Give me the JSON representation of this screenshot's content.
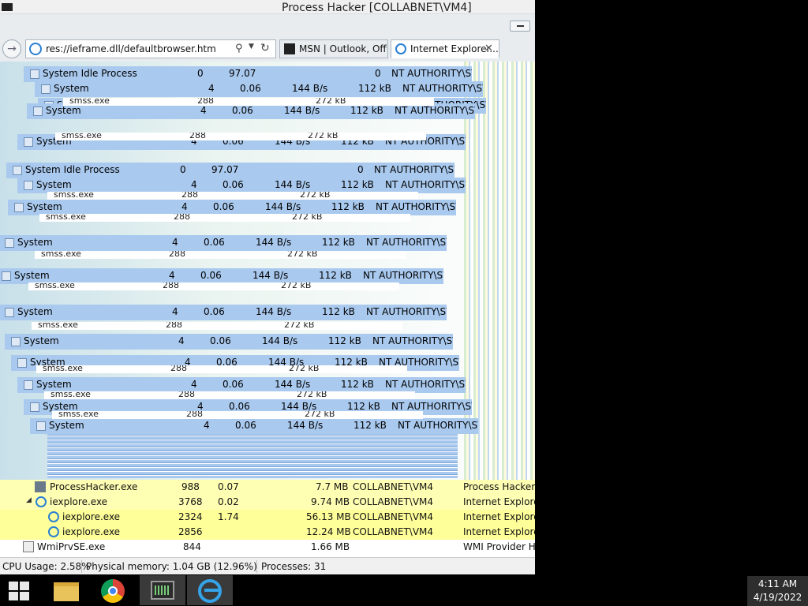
{
  "window": {
    "title": "Process Hacker [COLLABNET\\VM4]"
  },
  "browser": {
    "address": "res://ieframe.dll/defaultbrowser.htm",
    "tabs": [
      {
        "label": "MSN | Outlook, Off..."
      },
      {
        "label": "Internet Explorer..."
      }
    ],
    "icons": {
      "forward": "forward-arrow-icon",
      "search": "search-icon",
      "refresh": "refresh-icon",
      "close": "close-icon"
    },
    "glyphs": {
      "forward": "→",
      "search": "⚲",
      "dropdown": "▼",
      "refresh": "↻",
      "close": "✕"
    }
  },
  "glitched_list": {
    "system_idle": {
      "name": "System Idle Process",
      "pid": "0",
      "cpu": "97.07",
      "mem": "0",
      "user": "NT AUTHORITY\\SYSTE"
    },
    "system": {
      "name": "System",
      "pid": "4",
      "cpu": "0.06",
      "io": "144 B/s",
      "mem": "112 kB",
      "user": "NT AUTHORITY\\SYSTE"
    },
    "smss": {
      "name": "smss.exe",
      "pid": "288",
      "mem": "272 kB"
    }
  },
  "processes": [
    {
      "name": "ProcessHacker.exe",
      "pid": "988",
      "cpu": "0.07",
      "mem": "7.7 MB",
      "user": "COLLABNET\\VM4",
      "desc": "Process Hacker",
      "icon": "process-hacker-icon"
    },
    {
      "name": "iexplore.exe",
      "pid": "3768",
      "cpu": "0.02",
      "mem": "9.74 MB",
      "user": "COLLABNET\\VM4",
      "desc": "Internet Explorer",
      "icon": "ie-icon"
    },
    {
      "name": "iexplore.exe",
      "pid": "2324",
      "cpu": "1.74",
      "mem": "56.13 MB",
      "user": "COLLABNET\\VM4",
      "desc": "Internet Explorer",
      "icon": "ie-icon"
    },
    {
      "name": "iexplore.exe",
      "pid": "2856",
      "cpu": "",
      "mem": "12.24 MB",
      "user": "COLLABNET\\VM4",
      "desc": "Internet Explorer",
      "icon": "ie-icon"
    },
    {
      "name": "WmiPrvSE.exe",
      "pid": "844",
      "cpu": "",
      "mem": "1.66 MB",
      "user": "",
      "desc": "WMI Provider Ho",
      "icon": "wmi-icon"
    }
  ],
  "status": {
    "cpu": "CPU Usage: 2.58%",
    "memory": "Physical memory: 1.04 GB (12.96%)",
    "processes": "Processes: 31"
  },
  "taskbar": {
    "buttons": [
      "windows-start-icon",
      "file-explorer-icon",
      "chrome-icon",
      "process-hacker-icon",
      "internet-explorer-icon"
    ]
  },
  "clock": {
    "time": "4:11 AM",
    "date": "4/19/2022"
  },
  "colors": {
    "selection": "#a9c9ee",
    "highlight_yellow": "#ffff99",
    "ie_blue": "#2a7fd4"
  }
}
